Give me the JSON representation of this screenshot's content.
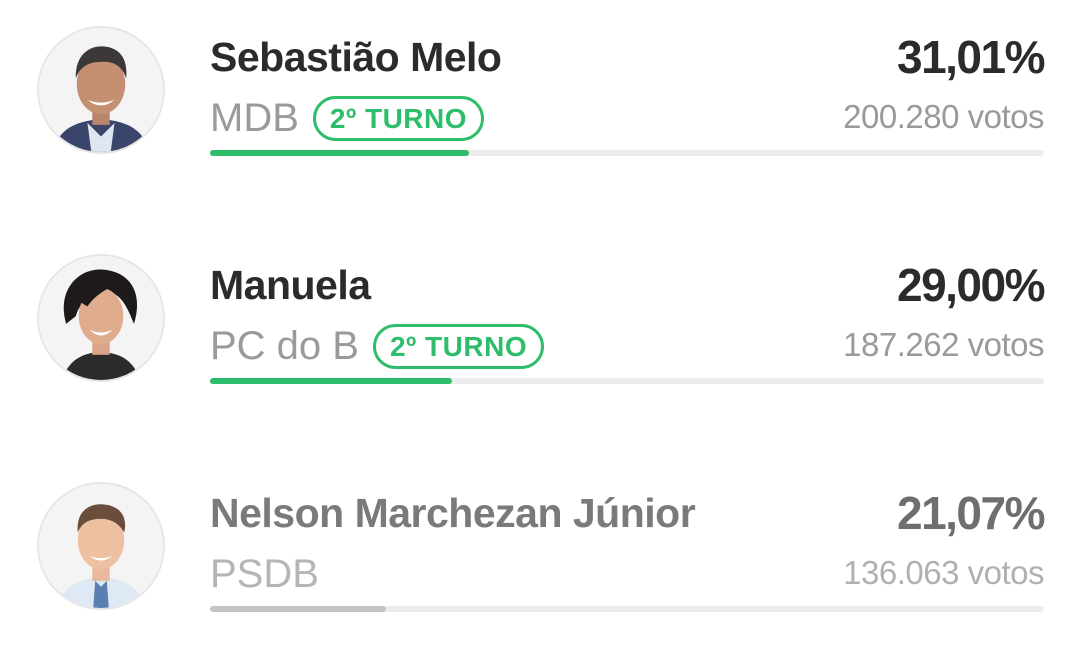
{
  "candidates": [
    {
      "name": "Sebastião Melo",
      "party": "MDB",
      "badge": "2º TURNO",
      "percent": "31,01%",
      "votes": "200.280 votos",
      "progress": 0.3101
    },
    {
      "name": "Manuela",
      "party": "PC do B",
      "badge": "2º TURNO",
      "percent": "29,00%",
      "votes": "187.262 votos",
      "progress": 0.29
    },
    {
      "name": "Nelson Marchezan Júnior",
      "party": "PSDB",
      "badge": "",
      "percent": "21,07%",
      "votes": "136.063 votos",
      "progress": 0.2107
    }
  ],
  "colors": {
    "accent": "#2ebd6b",
    "text": "#2b2b2b",
    "muted": "#9a9a9a",
    "track": "#ececec",
    "eliminated_bar": "#c4c4c4"
  },
  "icons": [
    "candidate-photo-melo",
    "candidate-photo-manuela",
    "candidate-photo-marchezan"
  ]
}
